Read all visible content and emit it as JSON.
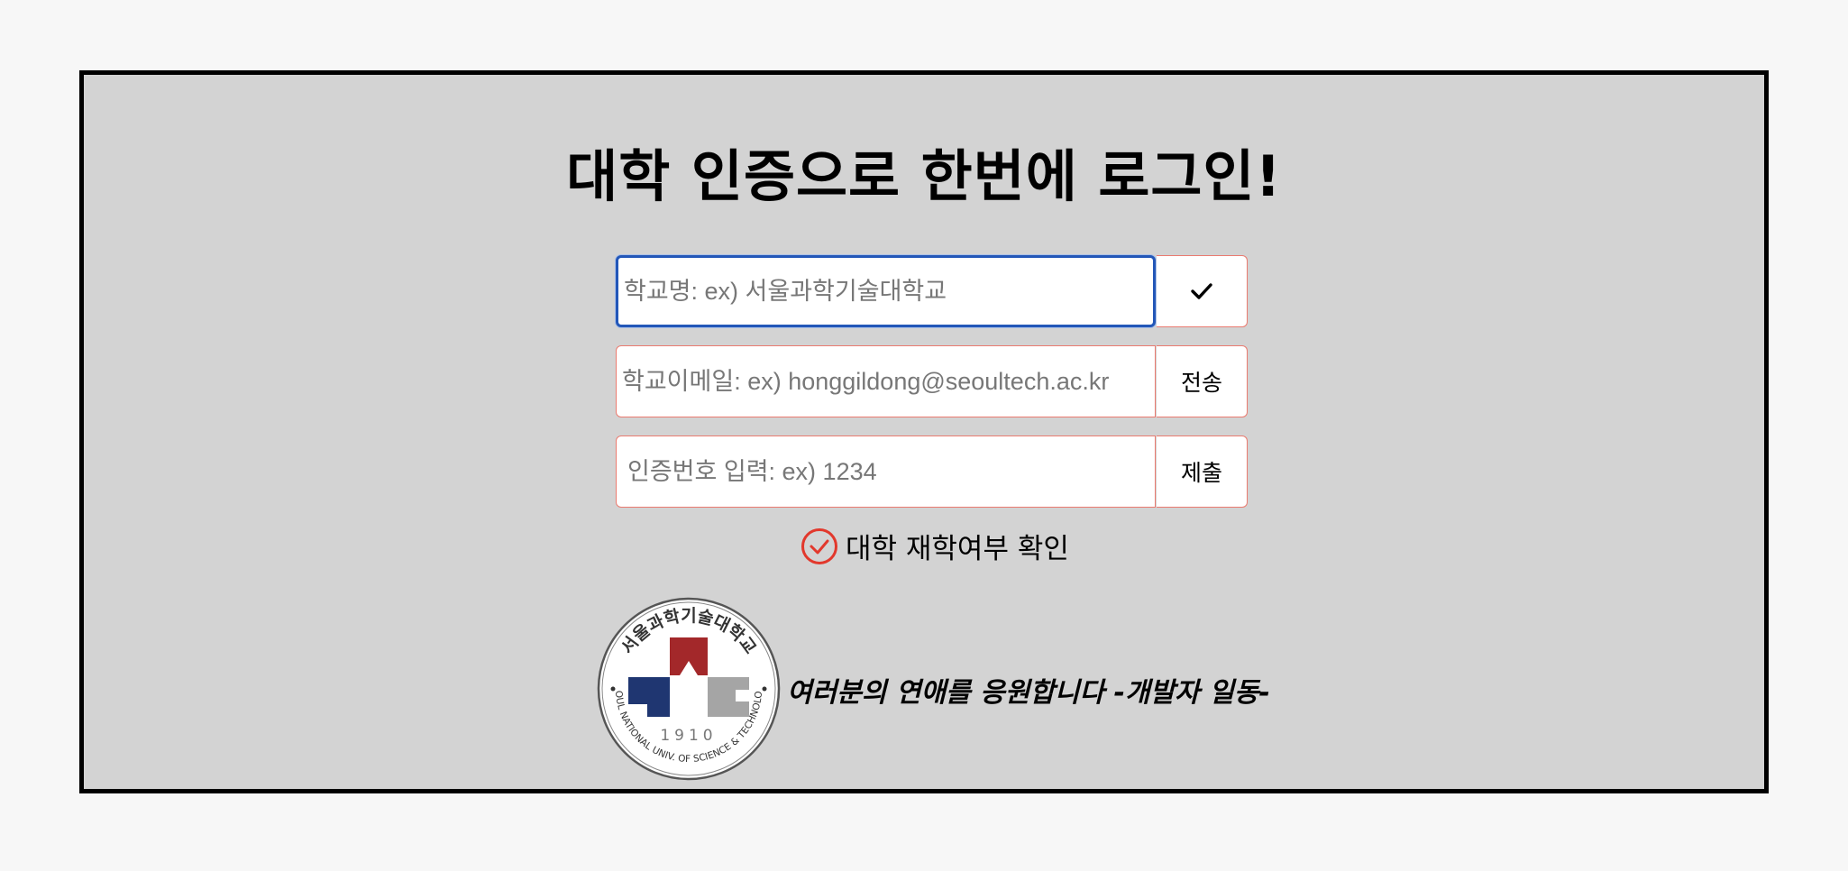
{
  "page": {
    "title": "대학 인증으로 한번에 로그인!"
  },
  "form": {
    "school": {
      "placeholder": "학교명: ex) 서울과학기술대학교",
      "value": "",
      "button_icon": "check-icon"
    },
    "email": {
      "placeholder": "학교이메일: ex) honggildong@seoultech.ac.kr",
      "value": "",
      "button_label": "전송"
    },
    "code": {
      "placeholder": "인증번호 입력: ex) 1234",
      "value": "",
      "button_label": "제출"
    }
  },
  "status": {
    "icon": "check-circle-icon",
    "label": "대학 재학여부 확인",
    "color": "#e2382c"
  },
  "footer": {
    "logo": {
      "text_top": "서울과학기술대학교",
      "year": "1910",
      "text_bottom": "SEOUL NATIONAL UNIV. OF SCIENCE & TECHNOLOGY",
      "red": "#a3282a",
      "blue": "#1f3671",
      "gray": "#a5a5a5"
    },
    "tagline": "여러분의 연애를 응원합니다 -개발자 일동-"
  },
  "colors": {
    "panel_bg": "#d3d3d3",
    "input_border": "#ea7b70",
    "focus_border": "#2357b8"
  }
}
